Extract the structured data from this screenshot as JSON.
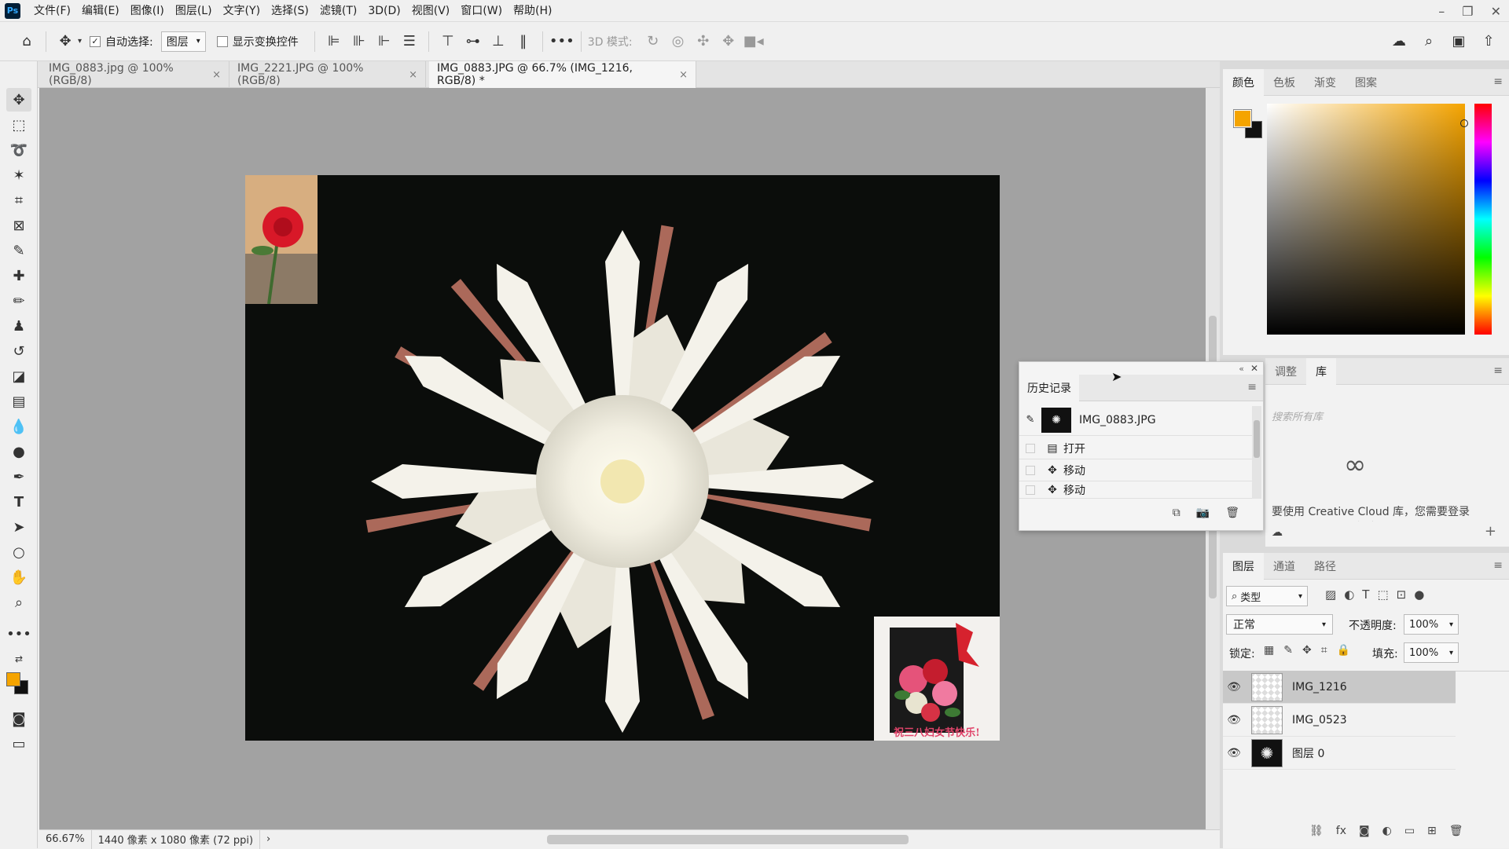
{
  "app": {
    "logo": "Ps"
  },
  "menu": [
    "文件(F)",
    "编辑(E)",
    "图像(I)",
    "图层(L)",
    "文字(Y)",
    "选择(S)",
    "滤镜(T)",
    "3D(D)",
    "视图(V)",
    "窗口(W)",
    "帮助(H)"
  ],
  "options": {
    "auto_select_label": "自动选择:",
    "auto_select_value": "图层",
    "show_transform_label": "显示变换控件",
    "mode_3d_label": "3D 模式:"
  },
  "doc_tabs": [
    {
      "label": "IMG_0883.jpg @ 100%(RGB/8)",
      "active": false
    },
    {
      "label": "IMG_2221.JPG @ 100%(RGB/8)",
      "active": false
    },
    {
      "label": "IMG_0883.JPG @ 66.7% (IMG_1216, RGB/8) *",
      "active": true
    }
  ],
  "status": {
    "zoom": "66.67%",
    "doc_info": "1440 像素 x 1080 像素 (72 ppi)"
  },
  "color_panel": {
    "tabs": [
      "颜色",
      "色板",
      "渐变",
      "图案"
    ],
    "foreground": "#f5a400",
    "background": "#111111"
  },
  "adjust_panel": {
    "tabs": [
      "调整",
      "库"
    ],
    "search_placeholder": "搜索所有库",
    "cc_message": "要使用 Creative Cloud 库，您需要登录 Creative Cloud 帐户"
  },
  "history": {
    "title": "历史记录",
    "snapshot": "IMG_0883.JPG",
    "items": [
      "打开",
      "移动",
      "移动"
    ]
  },
  "layers_panel": {
    "tabs": [
      "图层",
      "通道",
      "路径"
    ],
    "filter_label": "类型",
    "blend_mode": "正常",
    "opacity_label": "不透明度:",
    "opacity_value": "100%",
    "lock_label": "锁定:",
    "fill_label": "填充:",
    "fill_value": "100%",
    "layers": [
      {
        "name": "IMG_1216",
        "selected": true
      },
      {
        "name": "IMG_0523",
        "selected": false
      },
      {
        "name": "图层 0",
        "selected": false
      }
    ]
  },
  "image_caption": "祝三八妇女节快乐!"
}
